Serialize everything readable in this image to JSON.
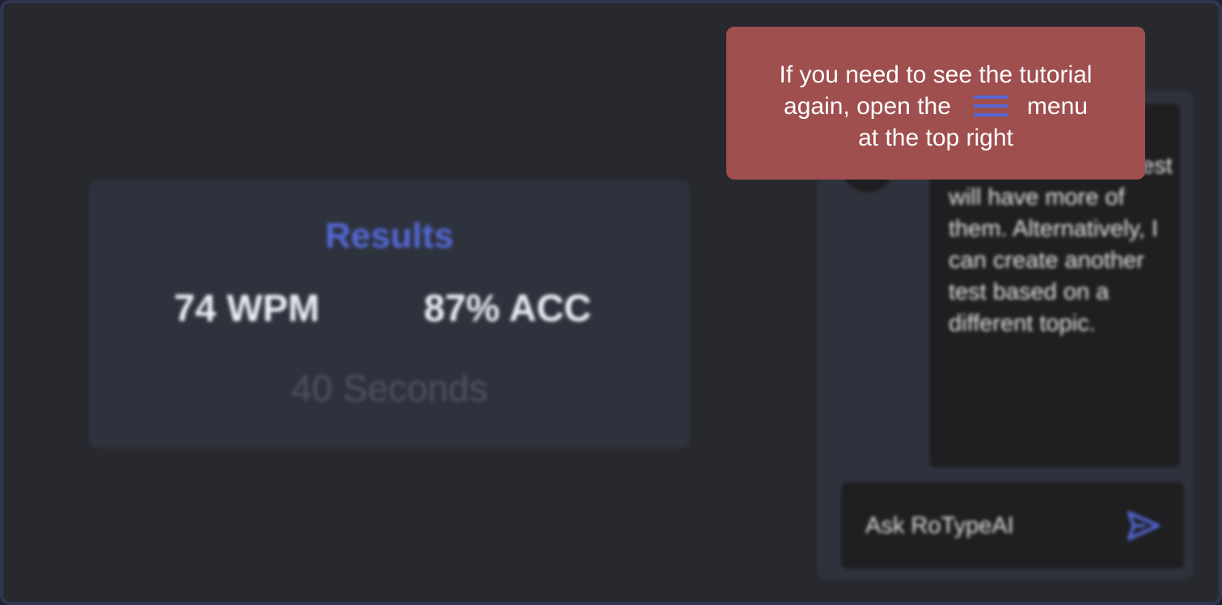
{
  "results": {
    "title": "Results",
    "wpm": "74 WPM",
    "accuracy": "87% ACC",
    "time": "40 Seconds"
  },
  "chat": {
    "message": "was “k”. The next test will have more of them. Alternatively, I can create another test based on a different topic.",
    "input_placeholder": "Ask RoTypeAI",
    "send_icon": "send-icon"
  },
  "tooltip": {
    "line1": "If you need to see the tutorial",
    "line2_before": "again, open the",
    "line2_after": "menu",
    "line3": "at the top right",
    "icon": "hamburger-menu-icon"
  },
  "colors": {
    "accent": "#5468d6",
    "tooltip_bg": "#9e4f4e",
    "background": "#28292e",
    "card": "#2e323d"
  }
}
